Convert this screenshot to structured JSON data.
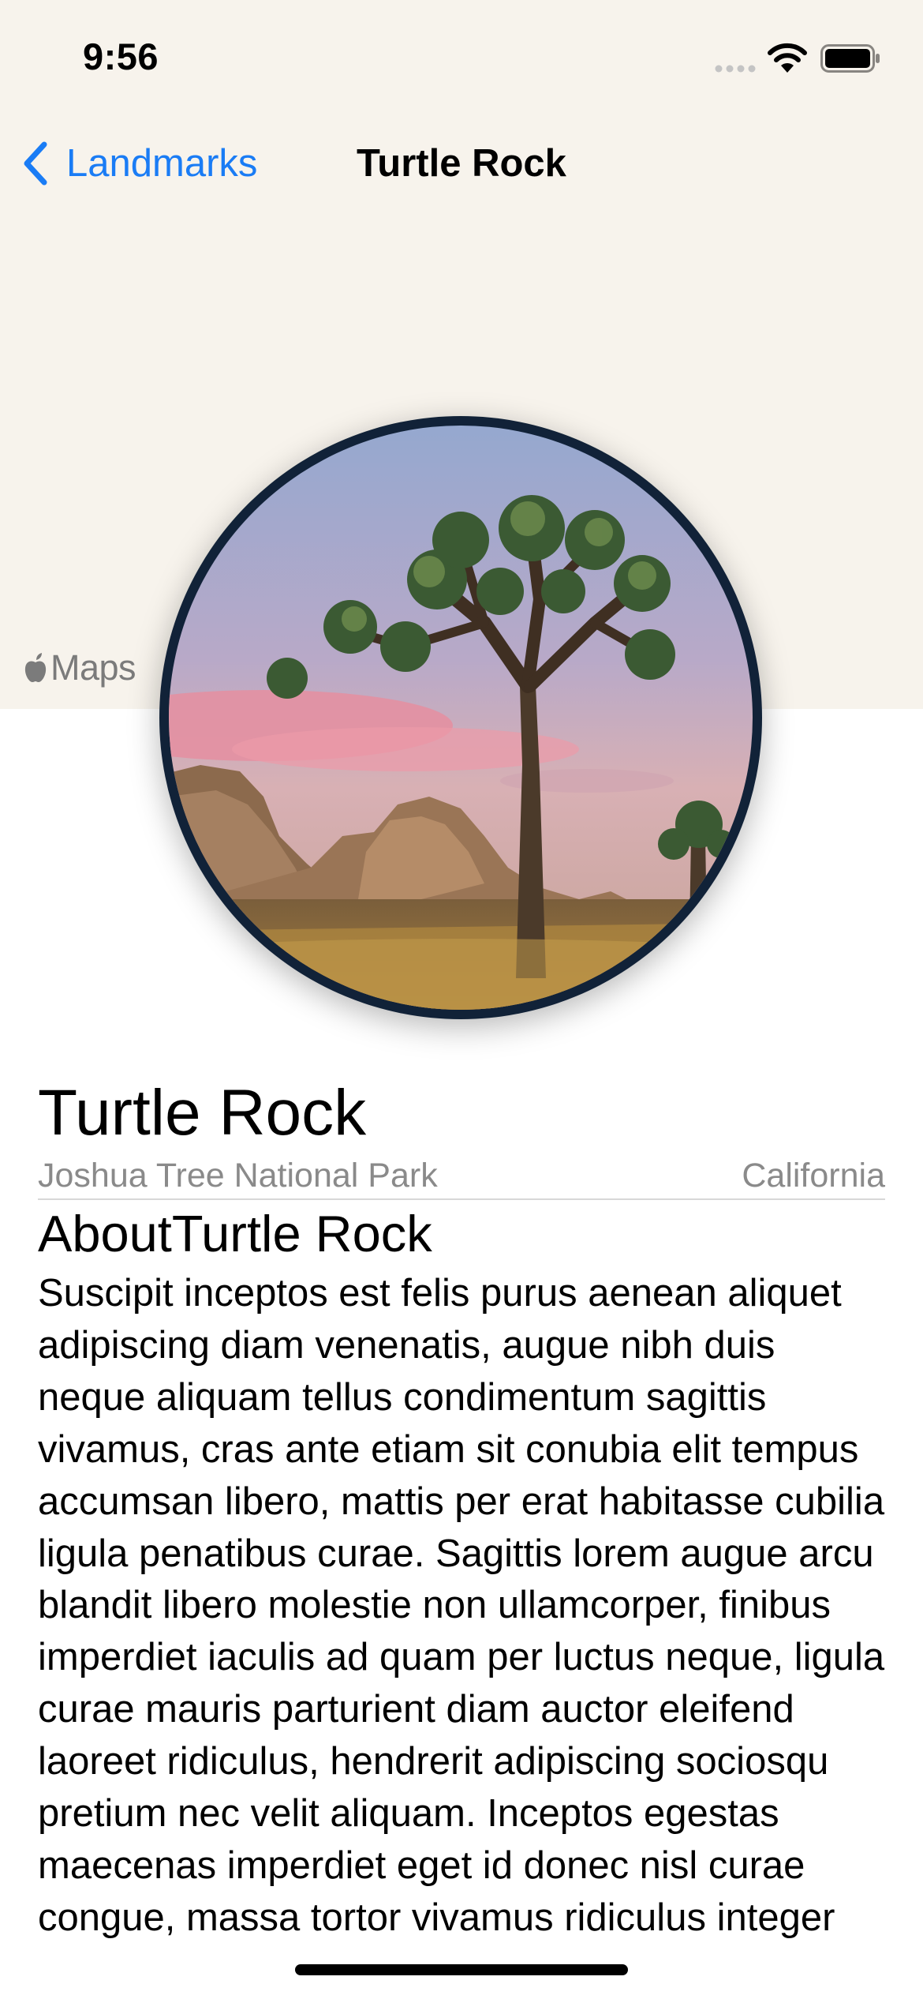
{
  "status_bar": {
    "time": "9:56",
    "icons": [
      "cellular-signal-icon",
      "wifi-icon",
      "battery-icon"
    ]
  },
  "navigation": {
    "back_label": "Landmarks",
    "back_icon": "chevron-left-icon",
    "title": "Turtle Rock"
  },
  "map": {
    "attribution": "Maps",
    "attribution_icon": "apple-logo-icon"
  },
  "landmark": {
    "name": "Turtle Rock",
    "park": "Joshua Tree National Park",
    "state": "California",
    "about_heading": "AboutTurtle Rock",
    "description": "Suscipit inceptos est felis purus aenean aliquet adipiscing diam venenatis, augue nibh duis neque aliquam tellus condimentum sagittis vivamus, cras ante etiam sit conubia elit tempus accumsan libero, mattis per erat habitasse cubilia ligula penatibus curae. Sagittis lorem augue arcu blandit libero molestie non ullamcorper, finibus imperdiet iaculis ad quam per luctus neque, ligula curae mauris parturient diam auctor eleifend laoreet ridiculus, hendrerit adipiscing sociosqu pretium nec velit aliquam. Inceptos egestas maecenas imperdiet eget id donec nisl curae congue, massa tortor vivamus ridiculus integer"
  },
  "colors": {
    "accent": "#1a7cf5",
    "map_background": "#f7f3ec",
    "secondary_text": "#8a8a8a",
    "photo_border": "#112238"
  }
}
